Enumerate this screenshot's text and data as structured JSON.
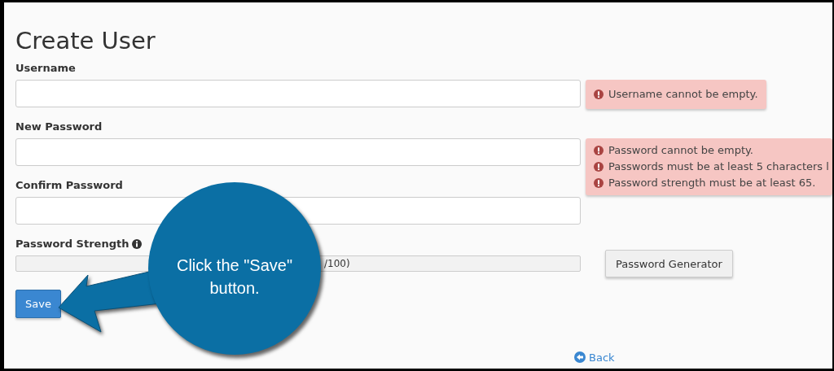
{
  "title": "Create User",
  "fields": [
    {
      "label": "Username",
      "errors": [
        "Username cannot be empty."
      ]
    },
    {
      "label": "New Password",
      "errors": [
        "Password cannot be empty.",
        "Passwords must be at least 5 characters l",
        "Password strength must be at least 65."
      ]
    },
    {
      "label": "Confirm Password"
    }
  ],
  "strength": {
    "label": "Password Strength",
    "level": 0,
    "reading": "/100)"
  },
  "generator_button": "Password Generator",
  "save_button": "Save",
  "back_link": "Back",
  "callout": {
    "text": "Click the \"Save\" button."
  }
}
